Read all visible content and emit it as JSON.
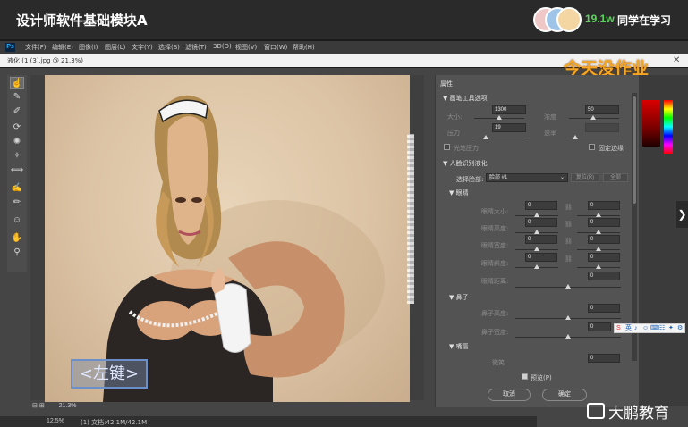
{
  "course": {
    "title": "设计师软件基础模块A",
    "learners_count": "19.1w",
    "learners_text": "同学在学习"
  },
  "menubar": {
    "logo": "Ps",
    "items": [
      "文件(F)",
      "编辑(E)",
      "图像(I)",
      "图层(L)",
      "文字(Y)",
      "选择(S)",
      "滤镜(T)",
      "3D(D)",
      "视图(V)",
      "窗口(W)",
      "帮助(H)"
    ]
  },
  "document": {
    "title": "液化 (1 (3).jpg @ 21.3%)",
    "overlay_note": "今天没作业",
    "canvas_zoom": "21.3%",
    "hint_badge": "<左键>"
  },
  "tools": [
    {
      "icon": "forward-warp-icon",
      "glyph": "☝"
    },
    {
      "icon": "reconstruct-icon",
      "glyph": "✎"
    },
    {
      "icon": "smooth-icon",
      "glyph": "✐"
    },
    {
      "icon": "twirl-icon",
      "glyph": "⟳"
    },
    {
      "icon": "pucker-icon",
      "glyph": "✺"
    },
    {
      "icon": "bloat-icon",
      "glyph": "✧"
    },
    {
      "icon": "push-left-icon",
      "glyph": "⟺"
    },
    {
      "icon": "freeze-mask-icon",
      "glyph": "✍"
    },
    {
      "icon": "thaw-mask-icon",
      "glyph": "✏"
    },
    {
      "icon": "face-tool-icon",
      "glyph": "☺"
    },
    {
      "icon": "hand-icon",
      "glyph": "✋"
    },
    {
      "icon": "zoom-icon",
      "glyph": "⚲"
    }
  ],
  "properties": {
    "panel_title": "属性",
    "brush_section": "画笔工具选项",
    "size_label": "大小:",
    "size_value": "1300",
    "density_label": "浓度",
    "density_value": "50",
    "pressure_label": "压力",
    "pressure_value": "19",
    "rate_label": "速率",
    "rate_value": "",
    "stylus_label": "光笔压力",
    "pin_edges_label": "固定边缘",
    "face_section": "人脸识别液化",
    "select_face_label": "选择脸部:",
    "select_face_value": "脸部 #1",
    "reset_label": "复位(R)",
    "all_label": "全部",
    "eyes_section": "眼睛",
    "eye_rows": [
      {
        "label": "眼睛大小:",
        "left": "0",
        "right": "0"
      },
      {
        "label": "眼睛高度:",
        "left": "0",
        "right": "0"
      },
      {
        "label": "眼睛宽度:",
        "left": "0",
        "right": "0"
      },
      {
        "label": "眼睛斜度:",
        "left": "0",
        "right": "0"
      },
      {
        "label": "眼睛距离:",
        "left": "",
        "right": "0"
      }
    ],
    "nose_section": "鼻子",
    "nose_rows": [
      {
        "label": "鼻子高度:",
        "value": "0"
      },
      {
        "label": "鼻子宽度:",
        "value": "0"
      }
    ],
    "mouth_section": "嘴唇",
    "smile_label": "微笑",
    "smile_value": "0",
    "preview_label": "预览(P)",
    "cancel_label": "取消",
    "ok_label": "确定"
  },
  "ime": [
    "S",
    "英",
    "♪",
    "☺",
    "⌨",
    "☷",
    "✦",
    "⚙"
  ],
  "status": {
    "zoom": "12.5%",
    "doc_info": "(1) 文档:42.1M/42.1M"
  },
  "brand": "大鹏教育",
  "colors": {
    "accent_green": "#5fd35f",
    "overlay_orange": "#f5a623",
    "ps_blue": "#31a8ff"
  }
}
